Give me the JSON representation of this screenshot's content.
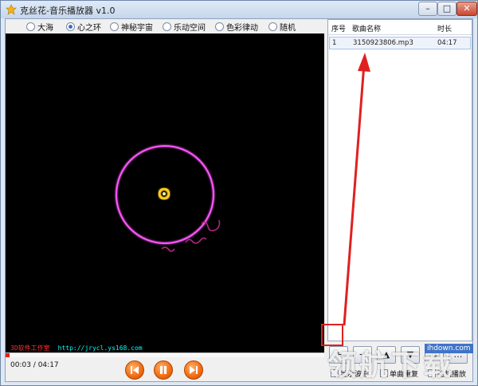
{
  "window": {
    "title": "克丝花-音乐播放器 v1.0",
    "minimize_glyph": "–",
    "maximize_glyph": "□",
    "close_glyph": "✕"
  },
  "visual_modes": [
    {
      "label": "大海",
      "selected": false
    },
    {
      "label": "心之环",
      "selected": true
    },
    {
      "label": "神秘宇宙",
      "selected": false
    },
    {
      "label": "乐动空间",
      "selected": false
    },
    {
      "label": "色彩律动",
      "selected": false
    },
    {
      "label": "随机",
      "selected": false
    }
  ],
  "visualizer": {
    "watermark_text": "3D软件工作室",
    "watermark_url": "http://jrycl.ys168.com"
  },
  "playback": {
    "current": "00:03",
    "separator": " / ",
    "total": "04:17",
    "progress_fraction": 0.012
  },
  "playlist": {
    "headers": {
      "index": "序号",
      "name": "歌曲名称",
      "duration": "时长"
    },
    "rows": [
      {
        "index": "1",
        "name": "3150923806.mp3",
        "duration": "04:17"
      }
    ]
  },
  "playlist_buttons": [
    "+",
    "−",
    "▲",
    "▼",
    "⌂",
    "…"
  ],
  "options": {
    "label_a": "显示波形",
    "label_b": "单曲重复",
    "label_c": "随机播放"
  },
  "overlay": {
    "site_mark": "领航下载",
    "site_url": "ihdown.com"
  },
  "colors": {
    "accent": "#f06a10",
    "ring": "#ff44ff",
    "core": "#ffcc00",
    "annotation": "#e02020"
  }
}
